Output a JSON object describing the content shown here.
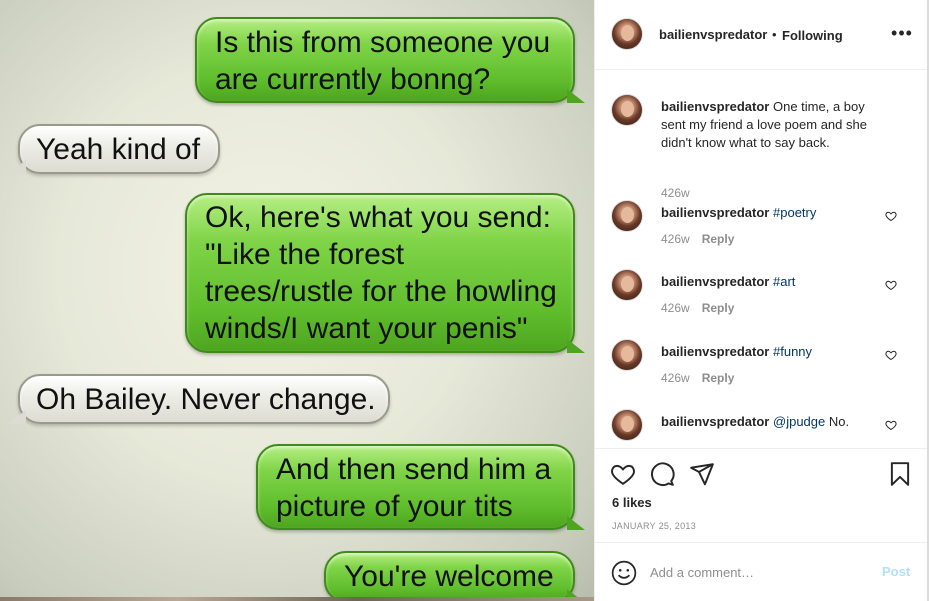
{
  "image": {
    "messages": [
      {
        "side": "me",
        "lines": [
          "Is this from someone you",
          "are currently bonng?"
        ]
      },
      {
        "side": "them",
        "lines": [
          "Yeah kind of"
        ]
      },
      {
        "side": "me",
        "lines": [
          "Ok, here's what you send:",
          "\"Like the forest",
          "trees/rustle for the howling",
          "winds/I want your penis\""
        ]
      },
      {
        "side": "them",
        "lines": [
          "Oh Bailey. Never change."
        ]
      },
      {
        "side": "me",
        "lines": [
          "And then send him a",
          "picture of your tits"
        ]
      },
      {
        "side": "me",
        "lines": [
          "You're welcome"
        ]
      }
    ]
  },
  "header": {
    "username": "bailienvspredator",
    "separator": "•",
    "follow_state": "Following",
    "more_icon": "more-horizontal-icon"
  },
  "comments": [
    {
      "username": "bailienvspredator",
      "text": " One time, a boy sent my friend a love poem and she didn't know what to say back.",
      "tag": "",
      "time": "426w",
      "reply": ""
    },
    {
      "username": "bailienvspredator",
      "text": " ",
      "tag": "#poetry",
      "time": "426w",
      "reply": "Reply"
    },
    {
      "username": "bailienvspredator",
      "text": " ",
      "tag": "#art",
      "time": "426w",
      "reply": "Reply"
    },
    {
      "username": "bailienvspredator",
      "text": " ",
      "tag": "#funny",
      "time": "426w",
      "reply": "Reply"
    },
    {
      "username": "bailienvspredator",
      "text": " ",
      "tag": "@jpudge",
      "after": " No.",
      "time": "",
      "reply": ""
    }
  ],
  "actions": {
    "icons": [
      "heart-icon",
      "comment-icon",
      "share-icon",
      "bookmark-icon"
    ],
    "likes": "6 likes",
    "date": "JANUARY 25, 2013"
  },
  "comment_box": {
    "placeholder": "Add a comment…",
    "post_label": "Post"
  },
  "colors": {
    "link": "#00376b",
    "muted": "#8e8e8e",
    "post_disabled": "#b2dffc",
    "bubble_green": "#6cc93a"
  }
}
